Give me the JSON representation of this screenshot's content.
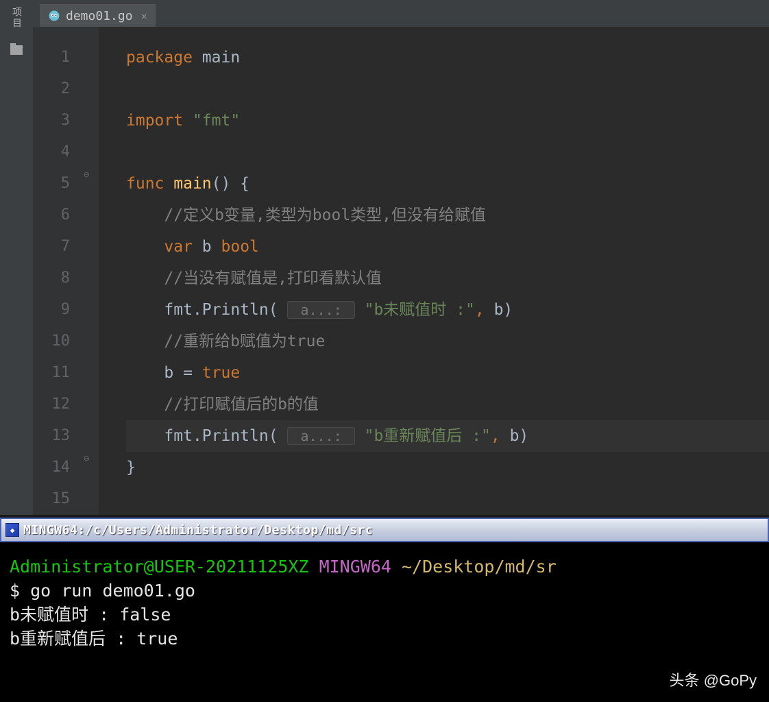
{
  "sidebar": {
    "project_label": "项目"
  },
  "tab": {
    "filename": "demo01.go",
    "close": "×"
  },
  "line_numbers": [
    "1",
    "2",
    "3",
    "4",
    "5",
    "6",
    "7",
    "8",
    "9",
    "10",
    "11",
    "12",
    "13",
    "14",
    "15"
  ],
  "code": {
    "l1_kw1": "package",
    "l1_id": "main",
    "l3_kw": "import",
    "l3_str": "\"fmt\"",
    "l5_kw": "func",
    "l5_fn": "main",
    "l5_rest": "() {",
    "l6_com": "//定义b变量,类型为bool类型,但没有给赋值",
    "l7_kw": "var",
    "l7_id": "b",
    "l7_type": "bool",
    "l8_com": "//当没有赋值是,打印看默认值",
    "l9_call1": "fmt",
    "l9_dot": ".",
    "l9_call2": "Println",
    "l9_p1": "(",
    "l9_hint": " a...: ",
    "l9_str": "\"b未赋值时 :\"",
    "l9_comma": ",",
    "l9_arg": " b)",
    "l10_com": "//重新给b赋值为true",
    "l11_id": "b",
    "l11_eq": " = ",
    "l11_kw": "true",
    "l12_com": "//打印赋值后的b的值",
    "l13_call1": "fmt",
    "l13_dot": ".",
    "l13_call2": "Println",
    "l13_p1": "(",
    "l13_hint": " a...: ",
    "l13_str": "\"b重新赋值后 :\"",
    "l13_comma": ",",
    "l13_arg": " b)",
    "l14": "}"
  },
  "terminal": {
    "title": "MINGW64:/c/Users/Administrator/Desktop/md/src",
    "user": "Administrator@USER-20211125XZ",
    "host": "MINGW64",
    "path": "~/Desktop/md/sr",
    "cmd": "$ go run demo01.go",
    "out1": "b未赋值时 : false",
    "out2": "b重新赋值后 : true"
  },
  "watermark": "头条 @GoPy"
}
